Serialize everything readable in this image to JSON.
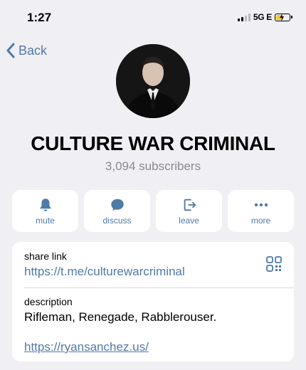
{
  "status": {
    "time": "1:27",
    "network": "5G E"
  },
  "nav": {
    "back_label": "Back"
  },
  "channel": {
    "name": "CULTURE WAR CRIMINAL",
    "subscribers": "3,094 subscribers"
  },
  "actions": [
    {
      "label": "mute",
      "icon": "bell-icon"
    },
    {
      "label": "discuss",
      "icon": "chat-bubble-icon"
    },
    {
      "label": "leave",
      "icon": "leave-icon"
    },
    {
      "label": "more",
      "icon": "ellipsis-icon"
    }
  ],
  "info": {
    "share_label": "share link",
    "share_url": "https://t.me/culturewarcriminal",
    "description_label": "description",
    "description": "Rifleman, Renegade, Rabblerouser.",
    "website": "https://ryansanchez.us/"
  },
  "colors": {
    "accent": "#4f7aa8",
    "background": "#efeff4",
    "card": "#ffffff"
  }
}
